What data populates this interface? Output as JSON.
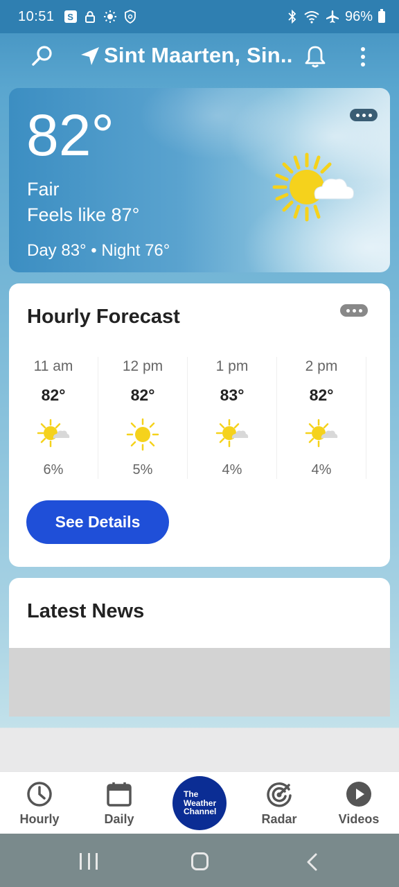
{
  "status_bar": {
    "time": "10:51",
    "battery": "96%",
    "s_badge": "S"
  },
  "app_bar": {
    "location": "Sint Maarten, Sin..."
  },
  "current": {
    "temperature": "82°",
    "condition": "Fair",
    "feels_like": "Feels like 87°",
    "day_night": "Day 83° • Night 76°",
    "icon": "partly-sunny-icon"
  },
  "hourly": {
    "title": "Hourly Forecast",
    "hours": [
      {
        "time": "11 am",
        "temp": "82°",
        "precip": "6%",
        "icon": "partly-sunny-icon"
      },
      {
        "time": "12 pm",
        "temp": "82°",
        "precip": "5%",
        "icon": "sunny-icon"
      },
      {
        "time": "1 pm",
        "temp": "83°",
        "precip": "4%",
        "icon": "partly-sunny-icon"
      },
      {
        "time": "2 pm",
        "temp": "82°",
        "precip": "4%",
        "icon": "partly-sunny-icon"
      }
    ],
    "details_button": "See Details"
  },
  "news": {
    "title": "Latest News"
  },
  "bottom_nav": {
    "hourly": "Hourly",
    "daily": "Daily",
    "logo_line1": "The",
    "logo_line2": "Weather",
    "logo_line3": "Channel",
    "radar": "Radar",
    "videos": "Videos"
  },
  "colors": {
    "accent_button": "#1f4fd8",
    "logo_bg": "#0b2d94",
    "sun_yellow": "#f5d21c"
  }
}
